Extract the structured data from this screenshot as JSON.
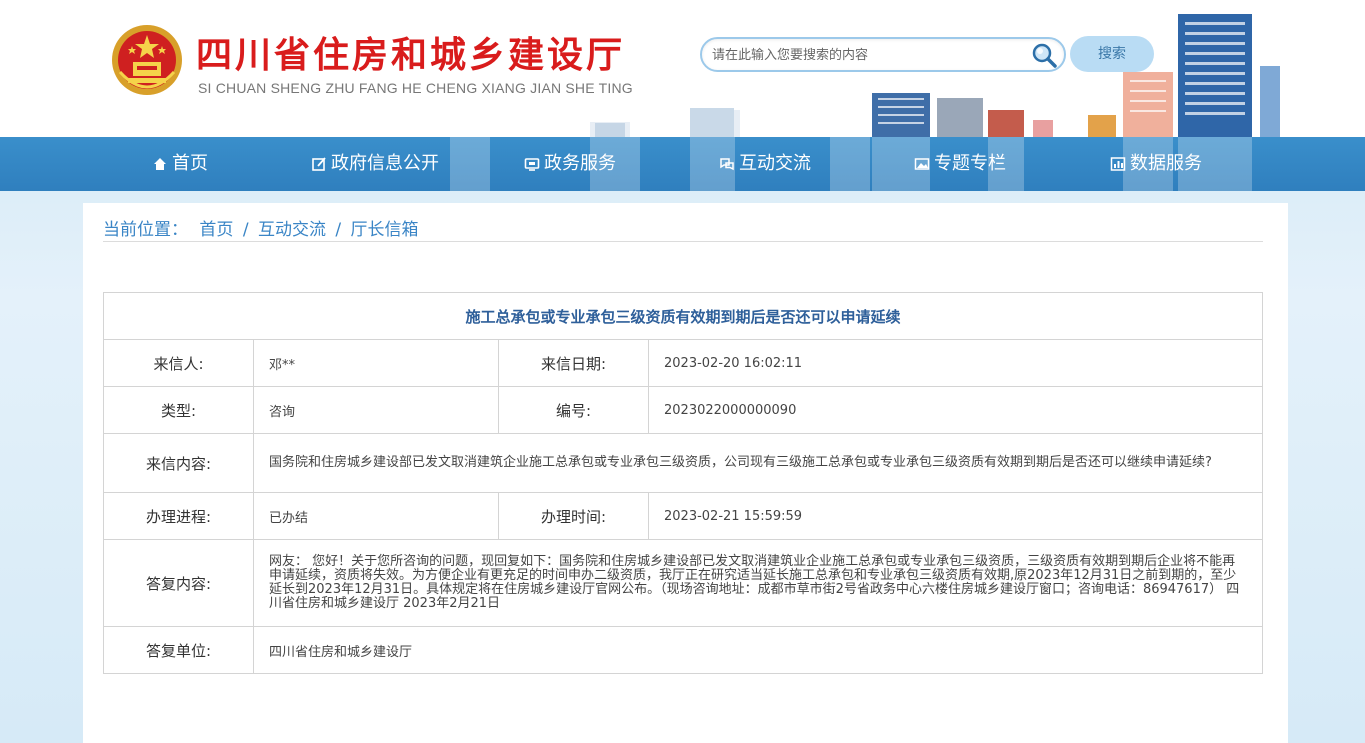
{
  "header": {
    "title": "四川省住房和城乡建设厅",
    "subtitle": "SI CHUAN SHENG ZHU FANG HE CHENG XIANG JIAN SHE TING",
    "search_placeholder": "请在此输入您要搜索的内容",
    "search_button": "搜索"
  },
  "nav": {
    "items": [
      {
        "label": "首页",
        "icon": "home-icon"
      },
      {
        "label": "政府信息公开",
        "icon": "edit-icon"
      },
      {
        "label": "政务服务",
        "icon": "monitor-icon"
      },
      {
        "label": "互动交流",
        "icon": "chat-icon"
      },
      {
        "label": "专题专栏",
        "icon": "image-icon"
      },
      {
        "label": "数据服务",
        "icon": "chart-icon"
      }
    ]
  },
  "breadcrumb": {
    "prefix": "当前位置：",
    "items": [
      "首页",
      "互动交流",
      "厅长信箱"
    ],
    "separator": "/"
  },
  "letter": {
    "title": "施工总承包或专业承包三级资质有效期到期后是否还可以申请延续",
    "sender_label": "来信人:",
    "sender": "邓**",
    "date_label": "来信日期:",
    "date": "2023-02-20 16:02:11",
    "type_label": "类型:",
    "type": "咨询",
    "number_label": "编号:",
    "number": "2023022000000090",
    "content_label": "来信内容:",
    "content": "国务院和住房城乡建设部已发文取消建筑企业施工总承包或专业承包三级资质，公司现有三级施工总承包或专业承包三级资质有效期到期后是否还可以继续申请延续?",
    "progress_label": "办理进程:",
    "progress": "已办结",
    "time_label": "办理时间:",
    "time": "2023-02-21 15:59:59",
    "answer_label": "答复内容:",
    "answer": "网友： 您好！关于您所咨询的问题，现回复如下：国务院和住房城乡建设部已发文取消建筑业企业施工总承包或专业承包三级资质，三级资质有效期到期后企业将不能再申请延续，资质将失效。为方便企业有更充足的时间申办二级资质，我厅正在研究适当延长施工总承包和专业承包三级资质有效期,原2023年12月31日之前到期的，至少延长到2023年12月31日。具体规定将在住房城乡建设厅官网公布。（现场咨询地址：成都市草市街2号省政务中心六楼住房城乡建设厅窗口；咨询电话：86947617） 四川省住房和城乡建设厅 2023年2月21日",
    "unit_label": "答复单位:",
    "unit": "四川省住房和城乡建设厅"
  },
  "colors": {
    "title_red": "#d91c1c",
    "nav_blue": "#3288c6",
    "link_blue": "#3a85c6",
    "table_title": "#2e5f9a"
  }
}
